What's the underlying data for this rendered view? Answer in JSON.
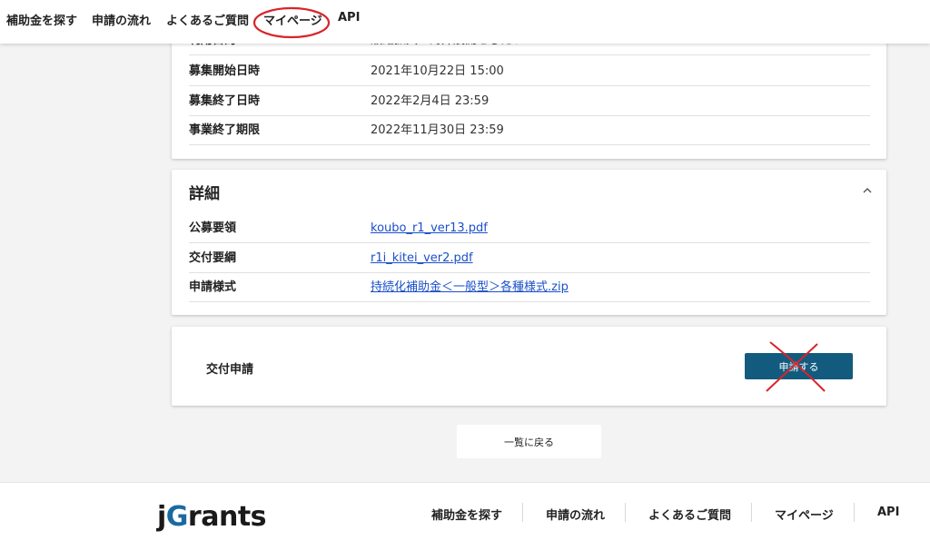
{
  "nav": {
    "items": [
      {
        "label": "補助金を探す"
      },
      {
        "label": "申請の流れ"
      },
      {
        "label": "よくあるご質問"
      },
      {
        "label": "マイページ"
      },
      {
        "label": "API"
      }
    ]
  },
  "schedule": {
    "cut_label": "利用目的",
    "cut_value": "販路拡大・海外展開をしたい",
    "rows": [
      {
        "label": "募集開始日時",
        "value": "2021年10月22日 15:00"
      },
      {
        "label": "募集終了日時",
        "value": "2022年2月4日 23:59"
      },
      {
        "label": "事業終了期限",
        "value": "2022年11月30日 23:59"
      }
    ]
  },
  "detail": {
    "title": "詳細",
    "rows": [
      {
        "label": "公募要領",
        "value": "koubo_r1_ver13.pdf"
      },
      {
        "label": "交付要綱",
        "value": "r1i_kitei_ver2.pdf"
      },
      {
        "label": "申請様式",
        "value": "持続化補助金＜一般型＞各種様式.zip"
      }
    ]
  },
  "apply": {
    "label": "交付申請",
    "button": "申請する"
  },
  "back_button": "一覧に戻る",
  "footer": {
    "logo_j": "j",
    "logo_g": "G",
    "logo_rest": "rants",
    "links": [
      {
        "label": "補助金を探す"
      },
      {
        "label": "申請の流れ"
      },
      {
        "label": "よくあるご質問"
      },
      {
        "label": "マイページ"
      },
      {
        "label": "API"
      }
    ]
  },
  "colors": {
    "accent": "#135b7e",
    "link": "#1b4fc9",
    "annotation": "#d9242a"
  }
}
